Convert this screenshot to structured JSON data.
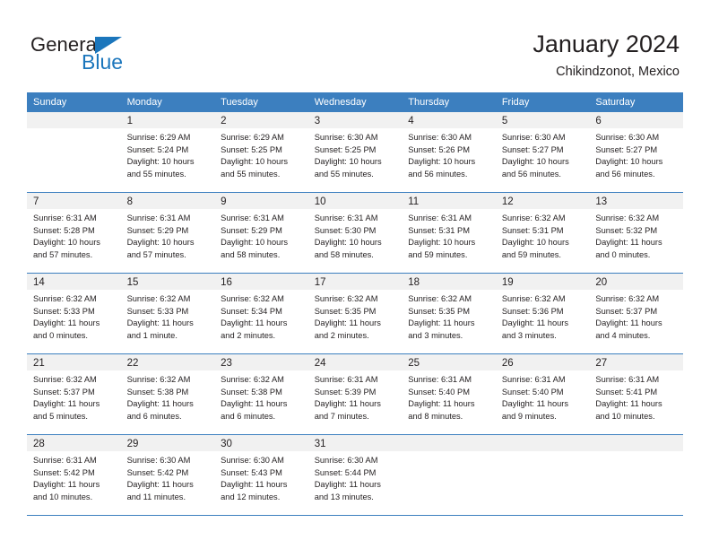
{
  "brand": {
    "name_top": "General",
    "name_bottom": "Blue",
    "accent_color": "#1b76bc"
  },
  "header": {
    "title": "January 2024",
    "subtitle": "Chikindzonot, Mexico"
  },
  "theme": {
    "header_row_bg": "#3c7fbf",
    "daynum_bg": "#f1f1f1",
    "text_color": "#231f20",
    "grid_line": "#3c7fbf"
  },
  "calendar": {
    "weekday_headers": [
      "Sunday",
      "Monday",
      "Tuesday",
      "Wednesday",
      "Thursday",
      "Friday",
      "Saturday"
    ],
    "weeks": [
      [
        {
          "day": "",
          "lines": []
        },
        {
          "day": "1",
          "lines": [
            "Sunrise: 6:29 AM",
            "Sunset: 5:24 PM",
            "Daylight: 10 hours",
            "and 55 minutes."
          ]
        },
        {
          "day": "2",
          "lines": [
            "Sunrise: 6:29 AM",
            "Sunset: 5:25 PM",
            "Daylight: 10 hours",
            "and 55 minutes."
          ]
        },
        {
          "day": "3",
          "lines": [
            "Sunrise: 6:30 AM",
            "Sunset: 5:25 PM",
            "Daylight: 10 hours",
            "and 55 minutes."
          ]
        },
        {
          "day": "4",
          "lines": [
            "Sunrise: 6:30 AM",
            "Sunset: 5:26 PM",
            "Daylight: 10 hours",
            "and 56 minutes."
          ]
        },
        {
          "day": "5",
          "lines": [
            "Sunrise: 6:30 AM",
            "Sunset: 5:27 PM",
            "Daylight: 10 hours",
            "and 56 minutes."
          ]
        },
        {
          "day": "6",
          "lines": [
            "Sunrise: 6:30 AM",
            "Sunset: 5:27 PM",
            "Daylight: 10 hours",
            "and 56 minutes."
          ]
        }
      ],
      [
        {
          "day": "7",
          "lines": [
            "Sunrise: 6:31 AM",
            "Sunset: 5:28 PM",
            "Daylight: 10 hours",
            "and 57 minutes."
          ]
        },
        {
          "day": "8",
          "lines": [
            "Sunrise: 6:31 AM",
            "Sunset: 5:29 PM",
            "Daylight: 10 hours",
            "and 57 minutes."
          ]
        },
        {
          "day": "9",
          "lines": [
            "Sunrise: 6:31 AM",
            "Sunset: 5:29 PM",
            "Daylight: 10 hours",
            "and 58 minutes."
          ]
        },
        {
          "day": "10",
          "lines": [
            "Sunrise: 6:31 AM",
            "Sunset: 5:30 PM",
            "Daylight: 10 hours",
            "and 58 minutes."
          ]
        },
        {
          "day": "11",
          "lines": [
            "Sunrise: 6:31 AM",
            "Sunset: 5:31 PM",
            "Daylight: 10 hours",
            "and 59 minutes."
          ]
        },
        {
          "day": "12",
          "lines": [
            "Sunrise: 6:32 AM",
            "Sunset: 5:31 PM",
            "Daylight: 10 hours",
            "and 59 minutes."
          ]
        },
        {
          "day": "13",
          "lines": [
            "Sunrise: 6:32 AM",
            "Sunset: 5:32 PM",
            "Daylight: 11 hours",
            "and 0 minutes."
          ]
        }
      ],
      [
        {
          "day": "14",
          "lines": [
            "Sunrise: 6:32 AM",
            "Sunset: 5:33 PM",
            "Daylight: 11 hours",
            "and 0 minutes."
          ]
        },
        {
          "day": "15",
          "lines": [
            "Sunrise: 6:32 AM",
            "Sunset: 5:33 PM",
            "Daylight: 11 hours",
            "and 1 minute."
          ]
        },
        {
          "day": "16",
          "lines": [
            "Sunrise: 6:32 AM",
            "Sunset: 5:34 PM",
            "Daylight: 11 hours",
            "and 2 minutes."
          ]
        },
        {
          "day": "17",
          "lines": [
            "Sunrise: 6:32 AM",
            "Sunset: 5:35 PM",
            "Daylight: 11 hours",
            "and 2 minutes."
          ]
        },
        {
          "day": "18",
          "lines": [
            "Sunrise: 6:32 AM",
            "Sunset: 5:35 PM",
            "Daylight: 11 hours",
            "and 3 minutes."
          ]
        },
        {
          "day": "19",
          "lines": [
            "Sunrise: 6:32 AM",
            "Sunset: 5:36 PM",
            "Daylight: 11 hours",
            "and 3 minutes."
          ]
        },
        {
          "day": "20",
          "lines": [
            "Sunrise: 6:32 AM",
            "Sunset: 5:37 PM",
            "Daylight: 11 hours",
            "and 4 minutes."
          ]
        }
      ],
      [
        {
          "day": "21",
          "lines": [
            "Sunrise: 6:32 AM",
            "Sunset: 5:37 PM",
            "Daylight: 11 hours",
            "and 5 minutes."
          ]
        },
        {
          "day": "22",
          "lines": [
            "Sunrise: 6:32 AM",
            "Sunset: 5:38 PM",
            "Daylight: 11 hours",
            "and 6 minutes."
          ]
        },
        {
          "day": "23",
          "lines": [
            "Sunrise: 6:32 AM",
            "Sunset: 5:38 PM",
            "Daylight: 11 hours",
            "and 6 minutes."
          ]
        },
        {
          "day": "24",
          "lines": [
            "Sunrise: 6:31 AM",
            "Sunset: 5:39 PM",
            "Daylight: 11 hours",
            "and 7 minutes."
          ]
        },
        {
          "day": "25",
          "lines": [
            "Sunrise: 6:31 AM",
            "Sunset: 5:40 PM",
            "Daylight: 11 hours",
            "and 8 minutes."
          ]
        },
        {
          "day": "26",
          "lines": [
            "Sunrise: 6:31 AM",
            "Sunset: 5:40 PM",
            "Daylight: 11 hours",
            "and 9 minutes."
          ]
        },
        {
          "day": "27",
          "lines": [
            "Sunrise: 6:31 AM",
            "Sunset: 5:41 PM",
            "Daylight: 11 hours",
            "and 10 minutes."
          ]
        }
      ],
      [
        {
          "day": "28",
          "lines": [
            "Sunrise: 6:31 AM",
            "Sunset: 5:42 PM",
            "Daylight: 11 hours",
            "and 10 minutes."
          ]
        },
        {
          "day": "29",
          "lines": [
            "Sunrise: 6:30 AM",
            "Sunset: 5:42 PM",
            "Daylight: 11 hours",
            "and 11 minutes."
          ]
        },
        {
          "day": "30",
          "lines": [
            "Sunrise: 6:30 AM",
            "Sunset: 5:43 PM",
            "Daylight: 11 hours",
            "and 12 minutes."
          ]
        },
        {
          "day": "31",
          "lines": [
            "Sunrise: 6:30 AM",
            "Sunset: 5:44 PM",
            "Daylight: 11 hours",
            "and 13 minutes."
          ]
        },
        {
          "day": "",
          "lines": []
        },
        {
          "day": "",
          "lines": []
        },
        {
          "day": "",
          "lines": []
        }
      ]
    ]
  }
}
